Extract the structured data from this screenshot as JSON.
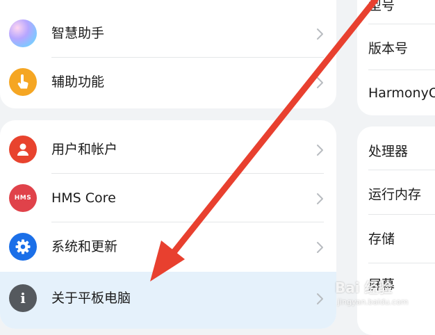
{
  "settings_list": {
    "group1": [
      {
        "label": "智慧助手",
        "icon": "assistant-icon"
      },
      {
        "label": "辅助功能",
        "icon": "accessibility-hand-icon"
      }
    ],
    "group2": [
      {
        "label": "用户和帐户",
        "icon": "user-icon"
      },
      {
        "label": "HMS Core",
        "icon": "hms-icon",
        "icon_text": "HMS"
      },
      {
        "label": "系统和更新",
        "icon": "gear-icon"
      },
      {
        "label": "关于平板电脑",
        "icon": "info-icon",
        "icon_text": "i",
        "selected": true
      }
    ]
  },
  "about_panel": {
    "top_items": [
      "型号",
      "版本号",
      "HarmonyO"
    ],
    "mid_items": [
      "处理器",
      "运行内存",
      "存储",
      "屏幕"
    ]
  },
  "annotation": {
    "type": "red-arrow",
    "color": "#e8402f"
  },
  "watermark": {
    "text": "Bai 经验",
    "sub": "jingyan.baidu.com"
  },
  "colors": {
    "background": "#f1f3f5",
    "card": "#ffffff",
    "selected_row": "#e5f1fb",
    "arrow": "#e8402f"
  }
}
